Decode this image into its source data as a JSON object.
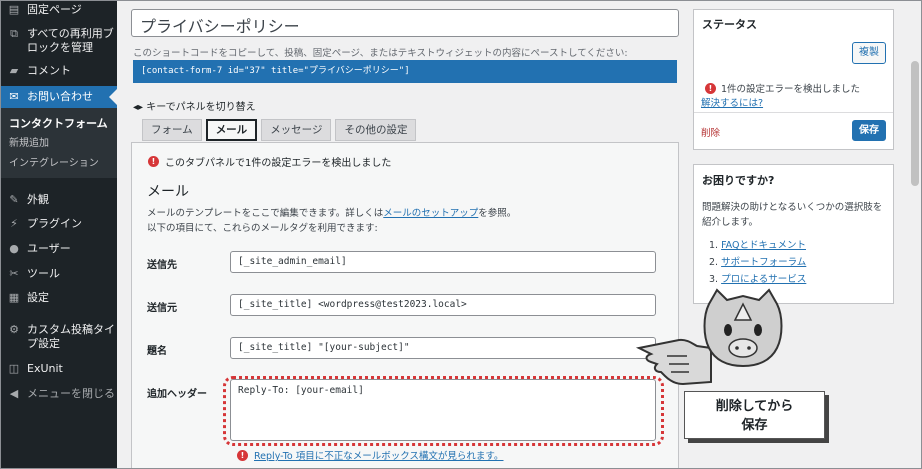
{
  "sidebar": {
    "items": [
      {
        "label": "固定ページ",
        "icon": "pages-icon"
      },
      {
        "label": "すべての再利用ブロックを管理",
        "icon": "reusable-block-icon"
      },
      {
        "label": "コメント",
        "icon": "comment-icon"
      },
      {
        "label": "お問い合わせ",
        "icon": "mail-icon"
      }
    ],
    "submenu": [
      "コンタクトフォーム",
      "新規追加",
      "インテグレーション"
    ],
    "lower": [
      {
        "label": "外観",
        "icon": "appearance-icon"
      },
      {
        "label": "プラグイン",
        "icon": "plugin-icon"
      },
      {
        "label": "ユーザー",
        "icon": "user-icon"
      },
      {
        "label": "ツール",
        "icon": "tools-icon"
      },
      {
        "label": "設定",
        "icon": "settings-icon"
      },
      {
        "label": "カスタム投稿タイプ設定",
        "icon": "gear-icon"
      },
      {
        "label": "ExUnit",
        "icon": "exunit-icon"
      },
      {
        "label": "メニューを閉じる",
        "icon": "collapse-icon"
      }
    ]
  },
  "form": {
    "title": "プライバシーポリシー",
    "shortcode_desc": "このショートコードをコピーして、投稿、固定ページ、またはテキストウィジェットの内容にペーストしてください:",
    "shortcode": "[contact-form-7 id=\"37\" title=\"プライバシーポリシー\"]",
    "kb_hint": "キーでパネルを切り替え"
  },
  "tabs": [
    "フォーム",
    "メール",
    "メッセージ",
    "その他の設定"
  ],
  "panel": {
    "error": "このタブパネルで1件の設定エラーを検出しました",
    "heading": "メール",
    "desc_pre": "メールのテンプレートをここで編集できます。詳しくは",
    "desc_link": "メールのセットアップ",
    "desc_post": "を参照。",
    "desc_line2": "以下の項目にて、これらのメールタグを利用できます:",
    "fields": [
      {
        "label": "送信先",
        "value": "[_site_admin_email]"
      },
      {
        "label": "送信元",
        "value": "[_site_title] <wordpress@test2023.local>"
      },
      {
        "label": "題名",
        "value": "[_site_title] \"[your-subject]\""
      }
    ],
    "header_label": "追加ヘッダー",
    "header_value": "Reply-To: [your-email]",
    "bottom_error": "Reply-To 項目に不正なメールボックス構文が見られます。"
  },
  "status": {
    "title": "ステータス",
    "duplicate": "複製",
    "error": "1件の設定エラーを検出しました",
    "how_to_fix": "解決するには?",
    "delete": "削除",
    "save": "保存"
  },
  "help": {
    "title": "お困りですか?",
    "text1": "問題解決の助けとなるいくつかの選択肢を",
    "text2": "紹介します。",
    "links": [
      "FAQとドキュメント",
      "サポートフォーラム",
      "プロによるサービス"
    ]
  },
  "callout": {
    "line1": "削除してから",
    "line2": "保存"
  },
  "colors": {
    "accent": "#2271b1",
    "error": "#d63638",
    "sidebar": "#1d2327"
  }
}
